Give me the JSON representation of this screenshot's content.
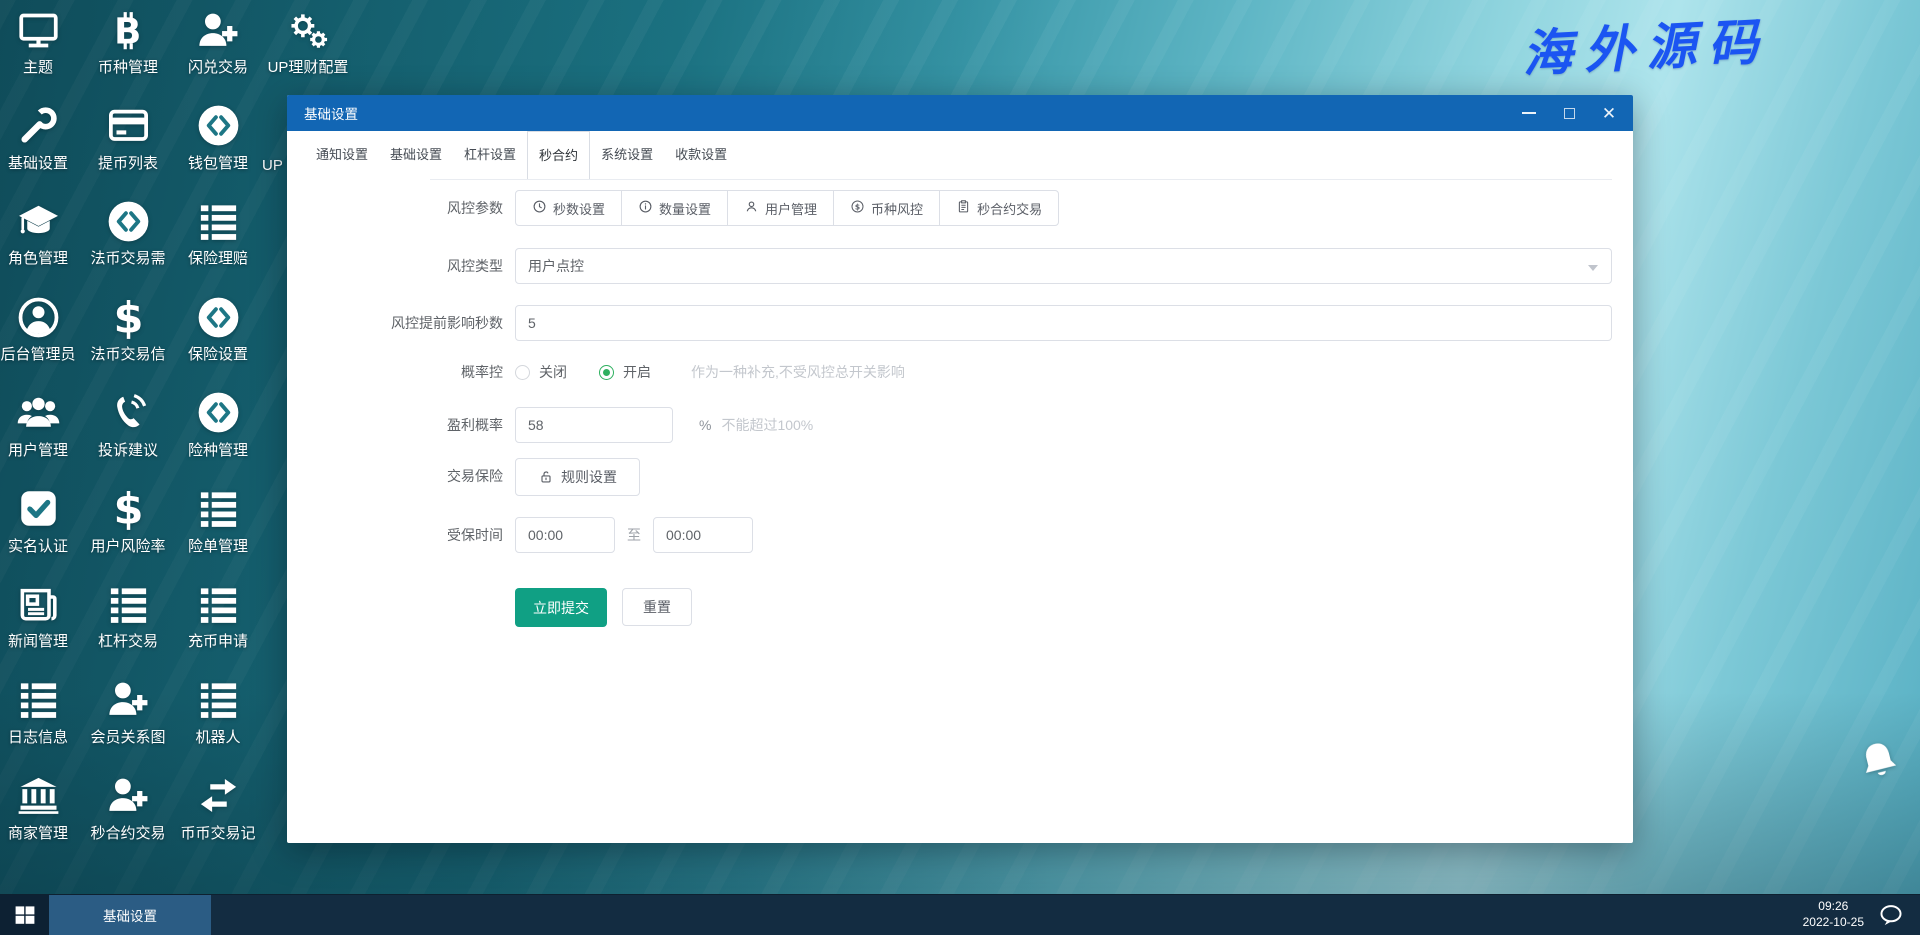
{
  "watermark": {
    "text": "海外源码"
  },
  "desktop": {
    "partial_label": "UP",
    "icons": [
      {
        "col": 0,
        "row": 0,
        "label": "主题",
        "icon": "monitor-icon"
      },
      {
        "col": 1,
        "row": 0,
        "label": "币种管理",
        "icon": "bitcoin-icon"
      },
      {
        "col": 2,
        "row": 0,
        "label": "闪兑交易",
        "icon": "user-plus-icon"
      },
      {
        "col": 3,
        "row": 0,
        "label": "UP理财配置",
        "icon": "gears-icon"
      },
      {
        "col": 0,
        "row": 1,
        "label": "基础设置",
        "icon": "wrench-icon"
      },
      {
        "col": 1,
        "row": 1,
        "label": "提币列表",
        "icon": "credit-card-icon"
      },
      {
        "col": 2,
        "row": 1,
        "label": "钱包管理",
        "icon": "coin-logo-icon"
      },
      {
        "col": 0,
        "row": 2,
        "label": "角色管理",
        "icon": "graduation-cap-icon"
      },
      {
        "col": 1,
        "row": 2,
        "label": "法币交易需",
        "icon": "coin-logo-icon"
      },
      {
        "col": 2,
        "row": 2,
        "label": "保险理赔",
        "icon": "list-icon"
      },
      {
        "col": 0,
        "row": 3,
        "label": "后台管理员",
        "icon": "user-circle-icon"
      },
      {
        "col": 1,
        "row": 3,
        "label": "法币交易信",
        "icon": "dollar-icon"
      },
      {
        "col": 2,
        "row": 3,
        "label": "保险设置",
        "icon": "coin-logo-icon"
      },
      {
        "col": 0,
        "row": 4,
        "label": "用户管理",
        "icon": "users-icon"
      },
      {
        "col": 1,
        "row": 4,
        "label": "投诉建议",
        "icon": "phone-icon"
      },
      {
        "col": 2,
        "row": 4,
        "label": "险种管理",
        "icon": "coin-logo-icon"
      },
      {
        "col": 0,
        "row": 5,
        "label": "实名认证",
        "icon": "check-square-icon"
      },
      {
        "col": 1,
        "row": 5,
        "label": "用户风险率",
        "icon": "dollar-icon"
      },
      {
        "col": 2,
        "row": 5,
        "label": "险单管理",
        "icon": "list-icon"
      },
      {
        "col": 0,
        "row": 6,
        "label": "新闻管理",
        "icon": "newspaper-icon"
      },
      {
        "col": 1,
        "row": 6,
        "label": "杠杆交易",
        "icon": "list-icon"
      },
      {
        "col": 2,
        "row": 6,
        "label": "充币申请",
        "icon": "list-icon"
      },
      {
        "col": 0,
        "row": 7,
        "label": "日志信息",
        "icon": "list-icon"
      },
      {
        "col": 1,
        "row": 7,
        "label": "会员关系图",
        "icon": "user-plus-icon"
      },
      {
        "col": 2,
        "row": 7,
        "label": "机器人",
        "icon": "list-icon"
      },
      {
        "col": 0,
        "row": 8,
        "label": "商家管理",
        "icon": "bank-icon"
      },
      {
        "col": 1,
        "row": 8,
        "label": "秒合约交易",
        "icon": "user-plus-icon"
      },
      {
        "col": 2,
        "row": 8,
        "label": "币币交易记",
        "icon": "swap-icon"
      }
    ]
  },
  "window": {
    "title": "基础设置",
    "tabs": [
      {
        "label": "通知设置",
        "active": false
      },
      {
        "label": "基础设置",
        "active": false
      },
      {
        "label": "杠杆设置",
        "active": false
      },
      {
        "label": "秒合约",
        "active": true
      },
      {
        "label": "系统设置",
        "active": false
      },
      {
        "label": "收款设置",
        "active": false
      }
    ],
    "form": {
      "risk_params": {
        "label": "风控参数",
        "buttons": [
          {
            "icon": "clock-icon",
            "label": "秒数设置"
          },
          {
            "icon": "info-icon",
            "label": "数量设置"
          },
          {
            "icon": "user-icon",
            "label": "用户管理"
          },
          {
            "icon": "dollar-circle-icon",
            "label": "币种风控"
          },
          {
            "icon": "clipboard-icon",
            "label": "秒合约交易"
          }
        ]
      },
      "risk_type": {
        "label": "风控类型",
        "value": "用户点控"
      },
      "advance_seconds": {
        "label": "风控提前影响秒数",
        "value": "5"
      },
      "probability": {
        "label": "概率控",
        "off": "关闭",
        "on": "开启",
        "selected": "开启",
        "hint": "作为一种补充,不受风控总开关影响"
      },
      "profit": {
        "label": "盈利概率",
        "value": "58",
        "unit": "%",
        "hint": "不能超过100%"
      },
      "insurance": {
        "label": "交易保险",
        "button": "规则设置"
      },
      "insured_time": {
        "label": "受保时间",
        "from": "00:00",
        "separator": "至",
        "to": "00:00"
      },
      "actions": {
        "submit": "立即提交",
        "reset": "重置"
      }
    }
  },
  "taskbar": {
    "app": "基础设置",
    "time": "09:26",
    "date": "2022-10-25"
  },
  "colors": {
    "titlebar": "#1266b4",
    "radio_green": "#2eb05f",
    "submit_teal": "#10a084",
    "taskbar": "#132c41",
    "taskbar_item": "#2b5c84",
    "watermark_blue": "#1b55f2"
  }
}
